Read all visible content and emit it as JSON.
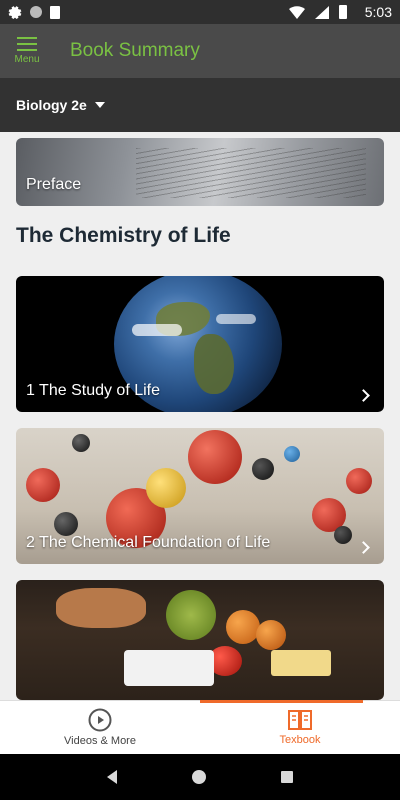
{
  "status_bar": {
    "time": "5:03"
  },
  "app_bar": {
    "menu_label": "Menu",
    "title": "Book Summary"
  },
  "book_selector": {
    "value": "Biology 2e"
  },
  "cards": {
    "preface": "Preface",
    "study": "1 The Study of Life",
    "chemical": "2 The Chemical Foundation of Life"
  },
  "section": {
    "title": "The Chemistry of Life"
  },
  "bottom_nav": {
    "videos_label": "Videos & More",
    "textbook_label": "Texbook"
  },
  "colors": {
    "accent_green": "#7ac143",
    "accent_orange": "#ef6a2a"
  }
}
